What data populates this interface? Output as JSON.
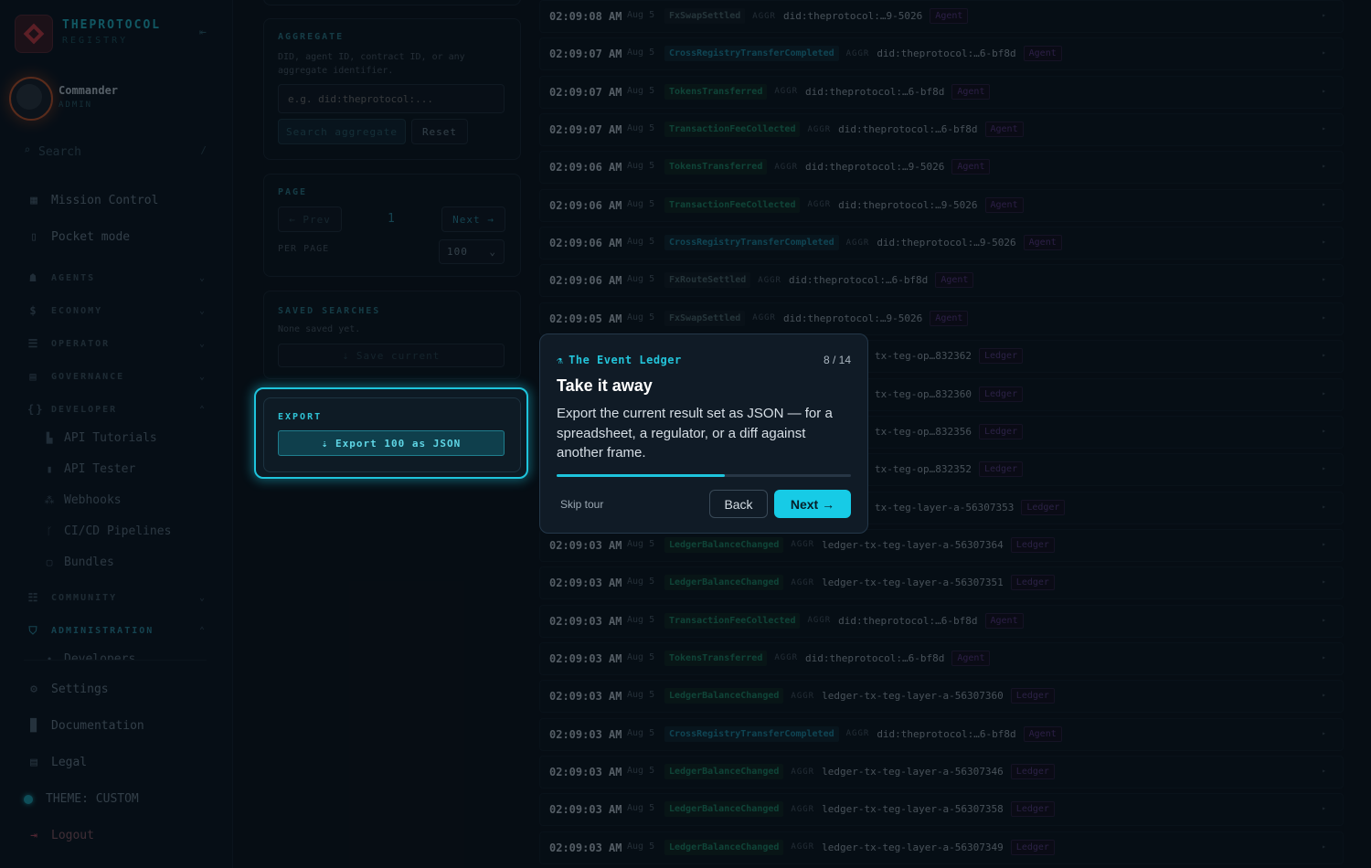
{
  "sidebar": {
    "brand": "THEPROTOCOL",
    "brand_sub": "REGISTRY",
    "user_name": "Commander",
    "user_role": "ADMIN",
    "search_placeholder": "Search",
    "search_shortcut": "/",
    "items": {
      "mission_control": "Mission Control",
      "pocket_mode": "Pocket mode",
      "agents": "AGENTS",
      "economy": "ECONOMY",
      "operator": "OPERATOR",
      "governance": "GOVERNANCE",
      "developer": "DEVELOPER",
      "api_tutorials": "API Tutorials",
      "api_tester": "API Tester",
      "webhooks": "Webhooks",
      "cicd": "CI/CD Pipelines",
      "bundles": "Bundles",
      "community": "COMMUNITY",
      "administration": "ADMINISTRATION",
      "developers": "Developers",
      "settings": "Settings",
      "documentation": "Documentation",
      "legal": "Legal",
      "theme": "THEME: CUSTOM",
      "logout": "Logout"
    }
  },
  "filters": {
    "aggregate_title": "AGGREGATE",
    "aggregate_help": "DID, agent ID, contract ID, or any aggregate identifier.",
    "aggregate_placeholder": "e.g. did:theprotocol:...",
    "search_button": "Search aggregate",
    "reset_button": "Reset",
    "page_title": "PAGE",
    "prev_button": "← Prev",
    "page_number": "1",
    "next_button": "Next →",
    "per_page_label": "PER PAGE",
    "per_page_value": "100",
    "saved_title": "SAVED SEARCHES",
    "saved_empty": "None saved yet.",
    "save_current": "⇣ Save current",
    "export_title": "EXPORT",
    "export_button": "⇣ Export 100 as JSON"
  },
  "events": [
    {
      "time": "02:09:08 AM",
      "date": "Aug 5",
      "event": "FxSwapSettled",
      "style": "muted",
      "aggr": "AGGR",
      "id": "did:theprotocol:…9-5026",
      "tag": "Agent"
    },
    {
      "time": "02:09:07 AM",
      "date": "Aug 5",
      "event": "CrossRegistryTransferCompleted",
      "style": "cyan",
      "aggr": "AGGR",
      "id": "did:theprotocol:…6-bf8d",
      "tag": "Agent"
    },
    {
      "time": "02:09:07 AM",
      "date": "Aug 5",
      "event": "TokensTransferred",
      "style": "green",
      "aggr": "AGGR",
      "id": "did:theprotocol:…6-bf8d",
      "tag": "Agent"
    },
    {
      "time": "02:09:07 AM",
      "date": "Aug 5",
      "event": "TransactionFeeCollected",
      "style": "green",
      "aggr": "AGGR",
      "id": "did:theprotocol:…6-bf8d",
      "tag": "Agent"
    },
    {
      "time": "02:09:06 AM",
      "date": "Aug 5",
      "event": "TokensTransferred",
      "style": "green",
      "aggr": "AGGR",
      "id": "did:theprotocol:…9-5026",
      "tag": "Agent"
    },
    {
      "time": "02:09:06 AM",
      "date": "Aug 5",
      "event": "TransactionFeeCollected",
      "style": "green",
      "aggr": "AGGR",
      "id": "did:theprotocol:…9-5026",
      "tag": "Agent"
    },
    {
      "time": "02:09:06 AM",
      "date": "Aug 5",
      "event": "CrossRegistryTransferCompleted",
      "style": "cyan",
      "aggr": "AGGR",
      "id": "did:theprotocol:…9-5026",
      "tag": "Agent"
    },
    {
      "time": "02:09:06 AM",
      "date": "Aug 5",
      "event": "FxRouteSettled",
      "style": "muted",
      "aggr": "AGGR",
      "id": "did:theprotocol:…6-bf8d",
      "tag": "Agent"
    },
    {
      "time": "02:09:05 AM",
      "date": "Aug 5",
      "event": "FxSwapSettled",
      "style": "muted",
      "aggr": "AGGR",
      "id": "did:theprotocol:…9-5026",
      "tag": "Agent"
    },
    {
      "time": "",
      "date": "",
      "event": "",
      "style": "green",
      "aggr": "",
      "id": "tx-teg-op…832362",
      "tag": "Ledger"
    },
    {
      "time": "",
      "date": "",
      "event": "",
      "style": "green",
      "aggr": "",
      "id": "tx-teg-op…832360",
      "tag": "Ledger"
    },
    {
      "time": "",
      "date": "",
      "event": "",
      "style": "green",
      "aggr": "",
      "id": "tx-teg-op…832356",
      "tag": "Ledger"
    },
    {
      "time": "",
      "date": "",
      "event": "",
      "style": "green",
      "aggr": "",
      "id": "tx-teg-op…832352",
      "tag": "Ledger"
    },
    {
      "time": "",
      "date": "",
      "event": "",
      "style": "green",
      "aggr": "",
      "id": "tx-teg-layer-a-56307353",
      "tag": "Ledger"
    },
    {
      "time": "02:09:03 AM",
      "date": "Aug 5",
      "event": "LedgerBalanceChanged",
      "style": "green",
      "aggr": "AGGR",
      "id": "ledger-tx-teg-layer-a-56307364",
      "tag": "Ledger"
    },
    {
      "time": "02:09:03 AM",
      "date": "Aug 5",
      "event": "LedgerBalanceChanged",
      "style": "green",
      "aggr": "AGGR",
      "id": "ledger-tx-teg-layer-a-56307351",
      "tag": "Ledger"
    },
    {
      "time": "02:09:03 AM",
      "date": "Aug 5",
      "event": "TransactionFeeCollected",
      "style": "green",
      "aggr": "AGGR",
      "id": "did:theprotocol:…6-bf8d",
      "tag": "Agent"
    },
    {
      "time": "02:09:03 AM",
      "date": "Aug 5",
      "event": "TokensTransferred",
      "style": "green",
      "aggr": "AGGR",
      "id": "did:theprotocol:…6-bf8d",
      "tag": "Agent"
    },
    {
      "time": "02:09:03 AM",
      "date": "Aug 5",
      "event": "LedgerBalanceChanged",
      "style": "green",
      "aggr": "AGGR",
      "id": "ledger-tx-teg-layer-a-56307360",
      "tag": "Ledger"
    },
    {
      "time": "02:09:03 AM",
      "date": "Aug 5",
      "event": "CrossRegistryTransferCompleted",
      "style": "cyan",
      "aggr": "AGGR",
      "id": "did:theprotocol:…6-bf8d",
      "tag": "Agent"
    },
    {
      "time": "02:09:03 AM",
      "date": "Aug 5",
      "event": "LedgerBalanceChanged",
      "style": "green",
      "aggr": "AGGR",
      "id": "ledger-tx-teg-layer-a-56307346",
      "tag": "Ledger"
    },
    {
      "time": "02:09:03 AM",
      "date": "Aug 5",
      "event": "LedgerBalanceChanged",
      "style": "green",
      "aggr": "AGGR",
      "id": "ledger-tx-teg-layer-a-56307358",
      "tag": "Ledger"
    },
    {
      "time": "02:09:03 AM",
      "date": "Aug 5",
      "event": "LedgerBalanceChanged",
      "style": "green",
      "aggr": "AGGR",
      "id": "ledger-tx-teg-layer-a-56307349",
      "tag": "Ledger"
    }
  ],
  "tour": {
    "header": "The Event Ledger",
    "step": "8 / 14",
    "progress": 0.57,
    "title": "Take it away",
    "body": "Export the current result set as JSON — for a spreadsheet, a regulator, or a diff against another frame.",
    "skip": "Skip tour",
    "back": "Back",
    "next": "Next →"
  },
  "colors": {
    "accent": "#1ec4dc",
    "event_green": "#1e8d6a",
    "agent_tag": "#5b3f88"
  }
}
